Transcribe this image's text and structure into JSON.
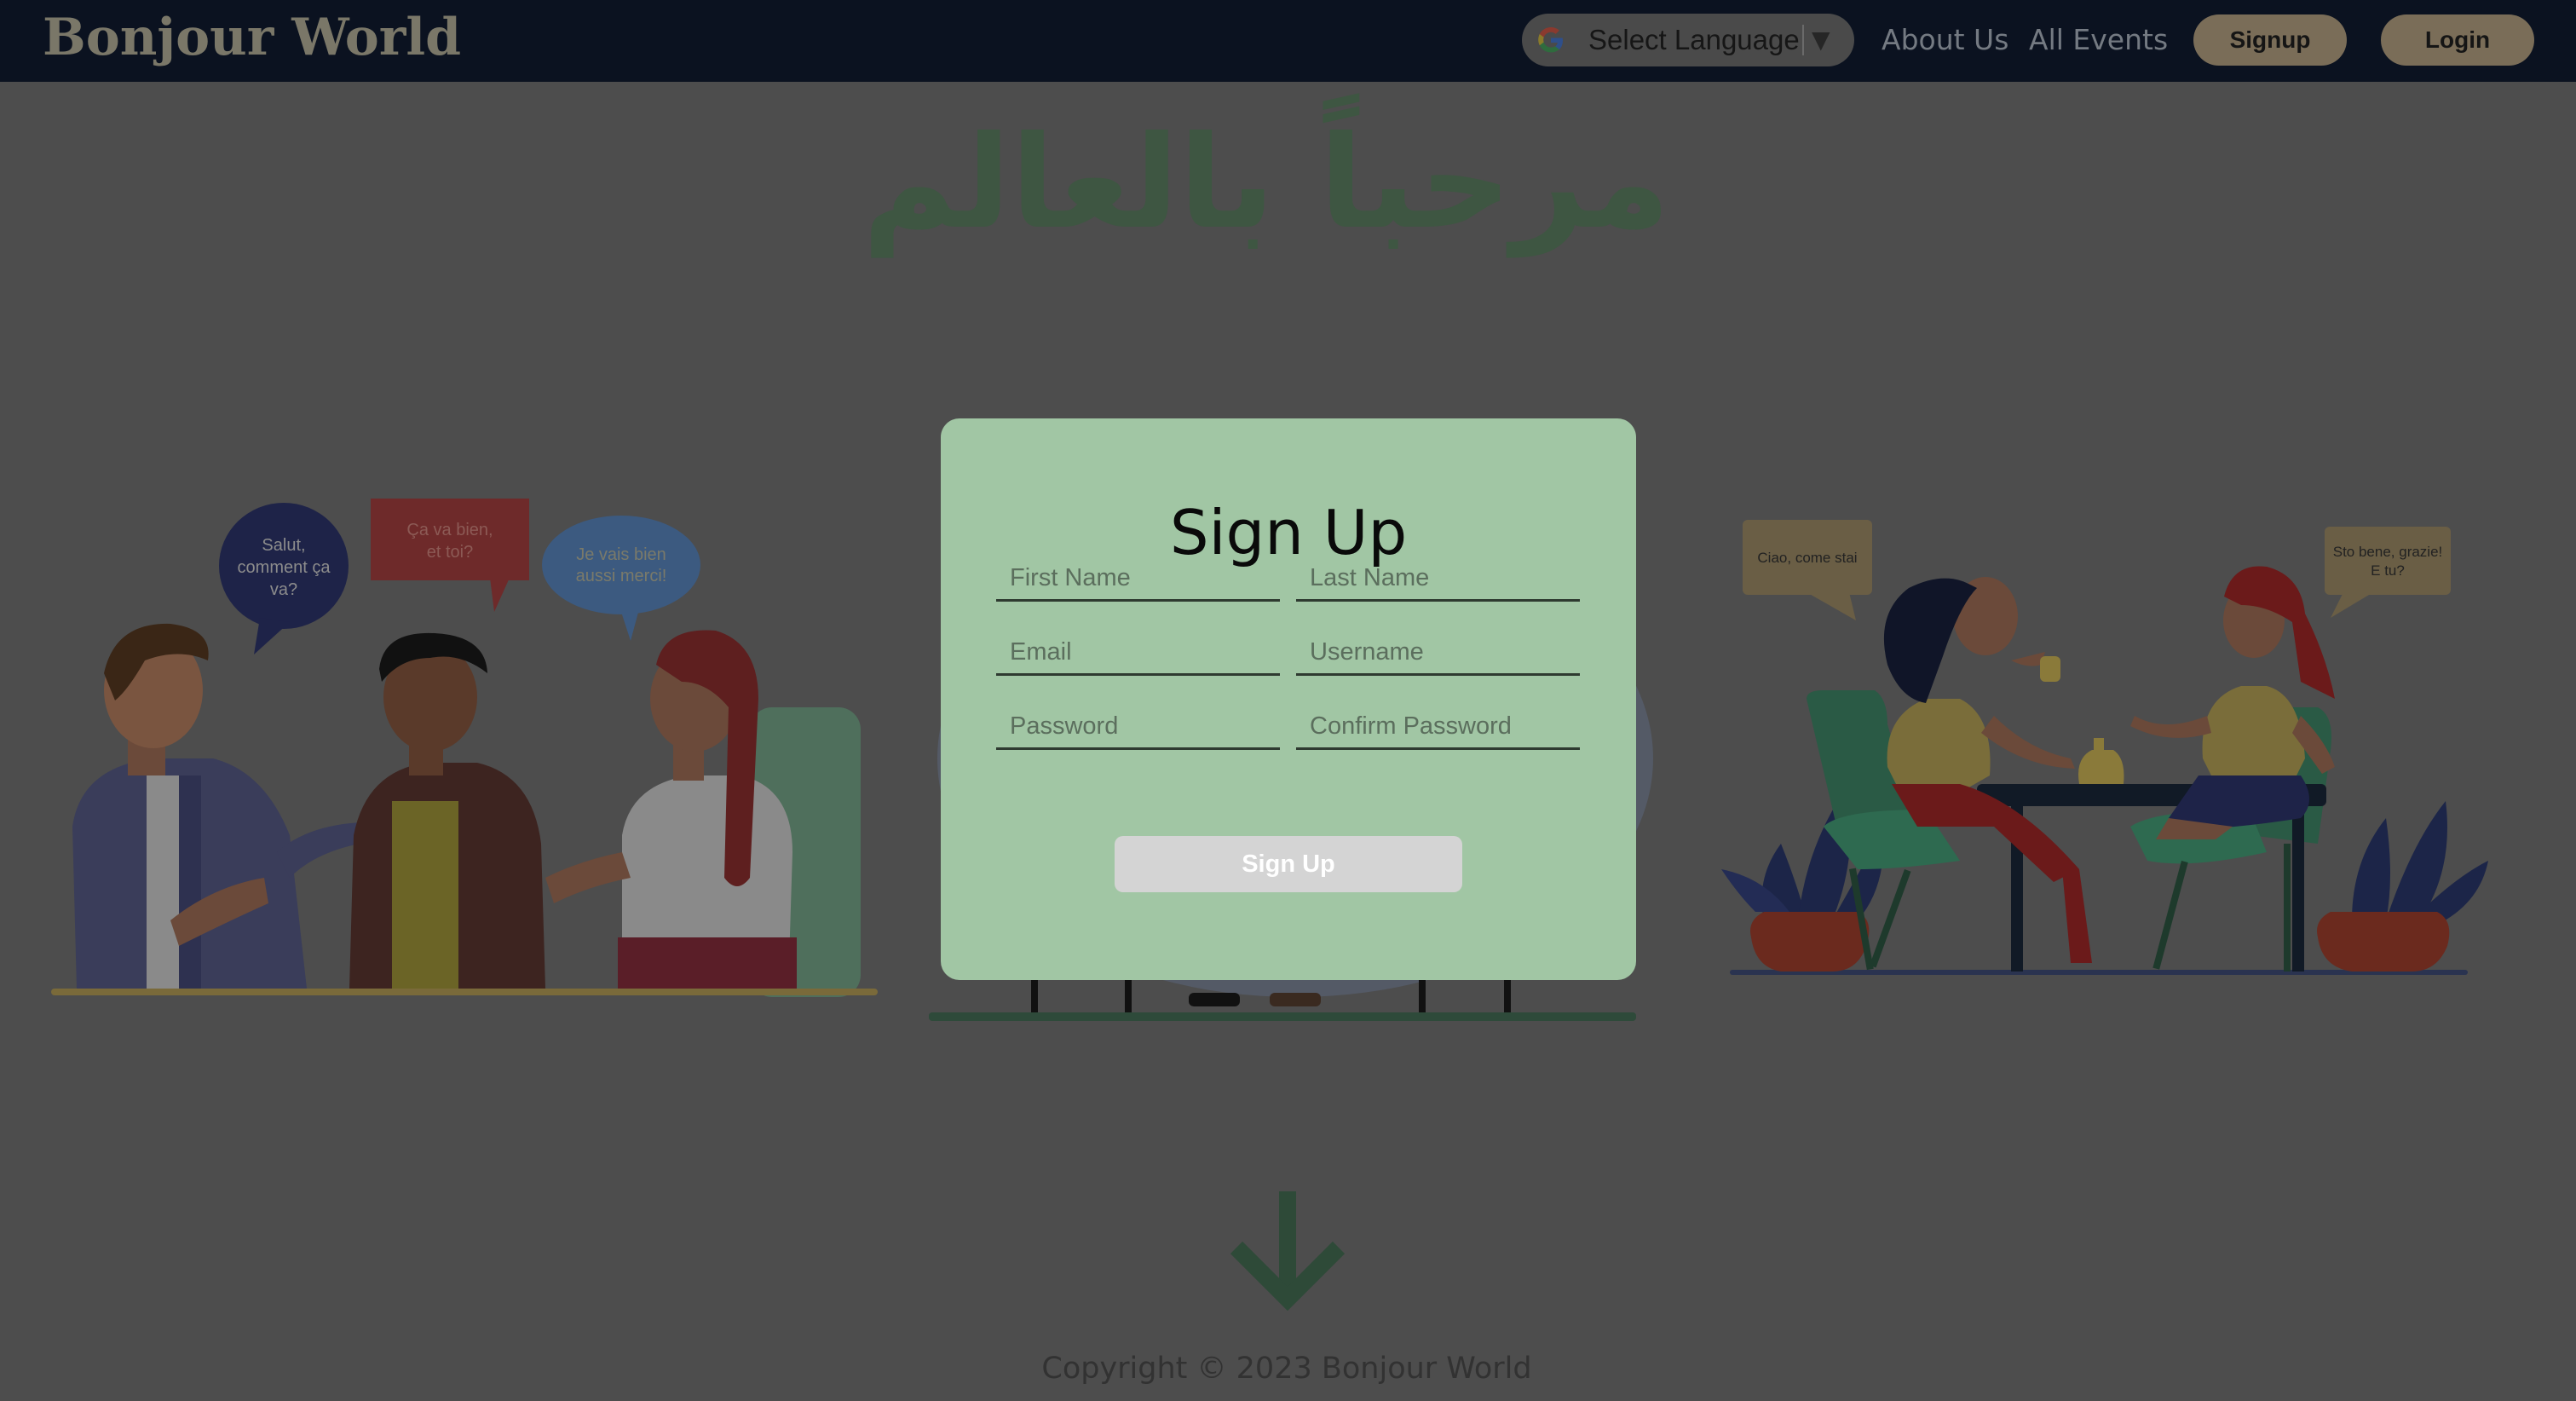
{
  "header": {
    "brand": "Bonjour World",
    "language_select_label": "Select Language",
    "nav_links": [
      "About Us",
      "All Events"
    ],
    "signup_label": "Signup",
    "login_label": "Login"
  },
  "hero": {
    "title": "مرحباً بالعالم"
  },
  "illustrations": {
    "left_bubbles": [
      "Salut,",
      "comment ça",
      "va?",
      "Ça va bien,",
      "et toi?",
      "Je vais bien",
      "aussi merci!"
    ],
    "right_bubbles": [
      "Ciao, come stai",
      "Sto bene, grazie!",
      "E tu?"
    ]
  },
  "signup_form": {
    "title": "Sign Up",
    "first_name_placeholder": "First Name",
    "last_name_placeholder": "Last Name",
    "email_placeholder": "Email",
    "username_placeholder": "Username",
    "password_placeholder": "Password",
    "confirm_password_placeholder": "Confirm Password",
    "submit_label": "Sign Up"
  },
  "footer": {
    "copyright": "Copyright © 2023 Bonjour World"
  },
  "icons": {
    "google": "google-g-icon",
    "caret": "caret-down-icon",
    "scroll": "arrow-down-icon"
  },
  "colors": {
    "navbar_bg": "#0b1220",
    "page_overlay": "#4d4d4d",
    "modal_bg": "#a1c6a4",
    "nav_button_bg": "#7a6d58",
    "submit_button_bg": "#d4d4d4",
    "hero_text": "#3e5642"
  }
}
